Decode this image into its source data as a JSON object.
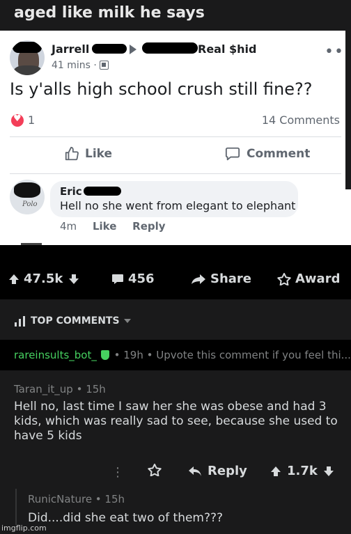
{
  "caption": {
    "title": "aged like milk he says"
  },
  "facebook_post": {
    "author": "Jarrell",
    "target": "Real $hid",
    "time": "41 mins ·",
    "more": "•••",
    "text": "Is y'alls high school crush still fine??",
    "reactions_count": "1",
    "comments_count": "14 Comments",
    "like_label": "Like",
    "comment_label": "Comment",
    "comment": {
      "author": "Eric",
      "avatar_signature": "Polo",
      "text": "Hell no she went from elegant to elephant",
      "time": "4m",
      "like_label": "Like",
      "reply_label": "Reply"
    }
  },
  "reddit_bar": {
    "upvotes": "47.5k",
    "comments": "456",
    "share": "Share",
    "award": "Award"
  },
  "sort": {
    "label": "TOP COMMENTS"
  },
  "bot_comment": {
    "user": "rareinsults_bot_",
    "time": "19h",
    "preview": "Upvote this comment if you feel thi..."
  },
  "comment_1": {
    "user": "Taran_it_up",
    "time": "15h",
    "meta": "Taran_it_up • 15h",
    "body": "Hell no, last time I saw her she was obese and had 3 kids, which was really sad to see, because she used to have 5 kids",
    "reply_label": "Reply",
    "score": "1.7k"
  },
  "comment_2": {
    "meta": "RunicNature • 15h",
    "body": "Did....did she eat two of them???"
  },
  "watermark": "imgflip.com",
  "colors": {
    "reddit_bg": "#1a1a1b",
    "reddit_black": "#000000",
    "reddit_text": "#d7dadc",
    "reddit_muted": "#818384",
    "bot_green": "#46d160",
    "fb_heart": "#f33e58"
  }
}
